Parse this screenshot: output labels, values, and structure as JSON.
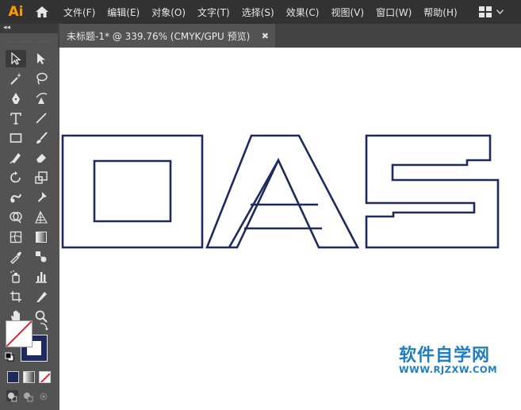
{
  "app": {
    "logo_text": "Ai"
  },
  "menu": {
    "items": [
      "文件(F)",
      "编辑(E)",
      "对象(O)",
      "文字(T)",
      "选择(S)",
      "效果(C)",
      "视图(V)",
      "窗口(W)",
      "帮助(H)"
    ]
  },
  "document_tab": {
    "title": "未标题-1* @ 339.76% (CMYK/GPU 预览)",
    "close": "✖"
  },
  "toolbar": {
    "collapse_glyph": "◂◂"
  },
  "colors": {
    "stroke_art": "#1e2a5e",
    "accent": "#ff9a00",
    "watermark": "#1d7fc1"
  },
  "artwork": {
    "text_outlined": "OAS"
  },
  "watermark": {
    "title": "软件自学网",
    "url": "WWW.RJZXW.COM"
  }
}
